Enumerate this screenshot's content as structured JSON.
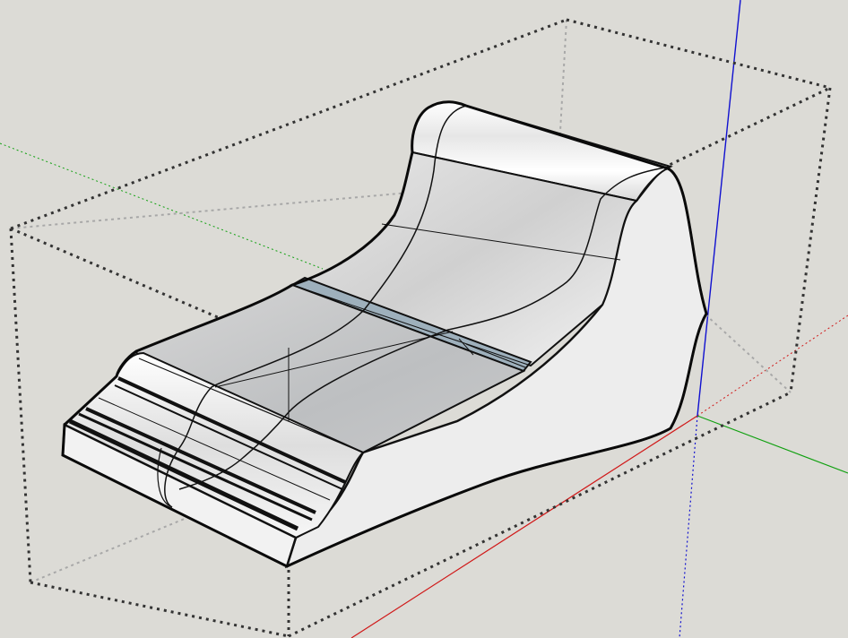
{
  "app": {
    "view": "3d-model-viewport"
  },
  "colors": {
    "background": "#dcdbd6",
    "axis_red": "#d01818",
    "axis_green": "#10a010",
    "axis_blue": "#1010d0",
    "bounding_box": "#333333",
    "edge": "#111111",
    "face_light": "#f4f4f4",
    "face_shadow": "#b9bcbe",
    "selected_strip": "#9eb0bc"
  },
  "scene": {
    "tool": "orbit",
    "selection": "model-group"
  }
}
